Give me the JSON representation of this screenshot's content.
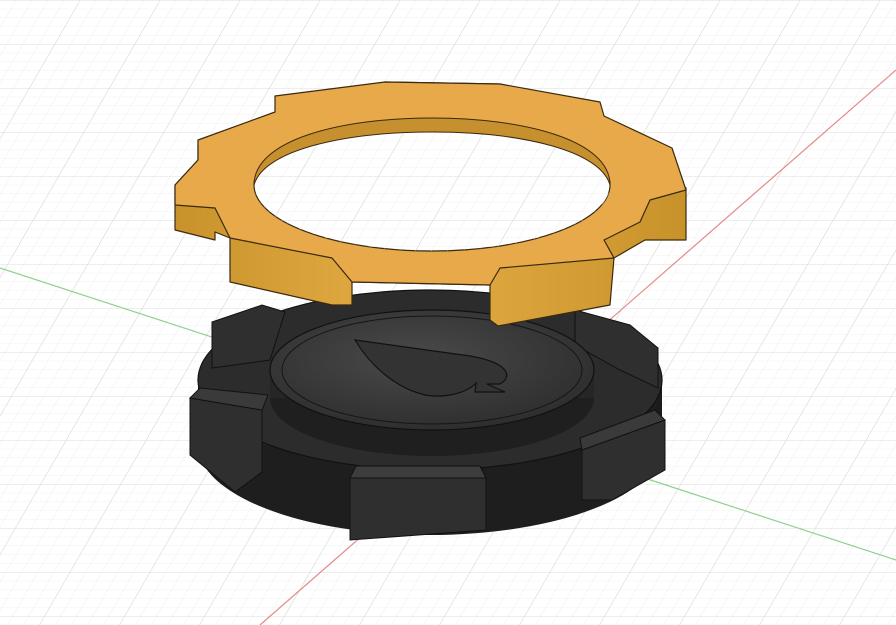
{
  "scene": {
    "kind": "3d-cad-viewport",
    "background_color": "#ffffff",
    "grid_color_minor": "#eeeeee",
    "grid_color_major": "#d8d8d8",
    "axis_x_color": "#e26464",
    "axis_y_color": "#79c779",
    "objects": [
      {
        "name": "gold-ring",
        "color": "#e0a53c",
        "shade": "#c48a22"
      },
      {
        "name": "poker-chip-base",
        "color": "#3a3a3a",
        "shade": "#202020",
        "emblem": "spade-icon"
      }
    ]
  }
}
